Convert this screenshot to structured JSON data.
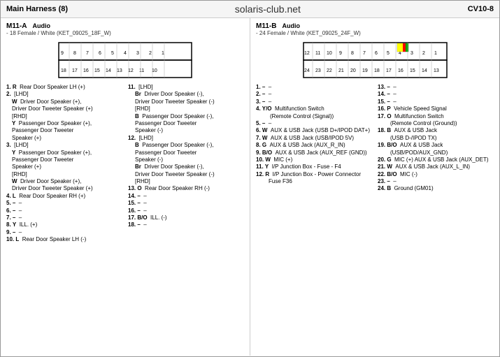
{
  "header": {
    "title": "Main Harness (8)",
    "site": "solaris-club.net",
    "code": "CV10-8"
  },
  "left_panel": {
    "connector": "M11-A",
    "type": "Audio",
    "desc": "- 18 Female / White (KET_09025_18F_W)",
    "pins": [
      {
        "num": "1.",
        "color": "R",
        "desc": "Rear Door Speaker LH (+)"
      },
      {
        "num": "2.",
        "color": "",
        "desc": "[LHD]"
      },
      {
        "num": "",
        "color": "W",
        "desc": "Driver Door Speaker (+),"
      },
      {
        "num": "",
        "color": "",
        "desc": "Driver Door Tweeter Speaker (+)"
      },
      {
        "num": "",
        "color": "",
        "desc": "[RHD]"
      },
      {
        "num": "",
        "color": "Y",
        "desc": "Passenger Door Speaker (+),"
      },
      {
        "num": "",
        "color": "",
        "desc": "Passenger Door Tweeter"
      },
      {
        "num": "",
        "color": "",
        "desc": "Speaker (+)"
      },
      {
        "num": "3.",
        "color": "",
        "desc": "[LHD]"
      },
      {
        "num": "",
        "color": "Y",
        "desc": "Passenger Door Speaker (+),"
      },
      {
        "num": "",
        "color": "",
        "desc": "Passenger Door Tweeter"
      },
      {
        "num": "",
        "color": "",
        "desc": "Speaker (+)"
      },
      {
        "num": "",
        "color": "",
        "desc": "[RHD]"
      },
      {
        "num": "",
        "color": "W",
        "desc": "Driver Door Speaker (+),"
      },
      {
        "num": "",
        "color": "",
        "desc": "Driver Door Tweeter Speaker (+)"
      },
      {
        "num": "4.",
        "color": "L",
        "desc": "Rear Door Speaker RH (+)"
      },
      {
        "num": "5.",
        "color": "–",
        "desc": "–"
      },
      {
        "num": "6.",
        "color": "–",
        "desc": "–"
      },
      {
        "num": "7.",
        "color": "–",
        "desc": "–"
      },
      {
        "num": "8.",
        "color": "Y",
        "desc": "ILL. (+)"
      },
      {
        "num": "9.",
        "color": "–",
        "desc": "–"
      },
      {
        "num": "10.",
        "color": "L",
        "desc": "Rear Door Speaker LH (-)"
      },
      {
        "num": "11.",
        "color": "",
        "desc": "[LHD]"
      },
      {
        "num": "",
        "color": "Br",
        "desc": "Driver Door Speaker (-),"
      },
      {
        "num": "",
        "color": "",
        "desc": "Driver Door Tweeter Speaker (-)"
      },
      {
        "num": "",
        "color": "",
        "desc": "[RHD]"
      },
      {
        "num": "",
        "color": "B",
        "desc": "Passenger Door Speaker (-),"
      },
      {
        "num": "",
        "color": "",
        "desc": "Passenger Door Tweeter"
      },
      {
        "num": "",
        "color": "",
        "desc": "Speaker (-)"
      },
      {
        "num": "12.",
        "color": "",
        "desc": "[LHD]"
      },
      {
        "num": "",
        "color": "B",
        "desc": "Passenger Door Speaker (-),"
      },
      {
        "num": "",
        "color": "",
        "desc": "Passenger Door Tweeter"
      },
      {
        "num": "",
        "color": "",
        "desc": "Speaker (-)"
      },
      {
        "num": "",
        "color": "Br",
        "desc": "Driver Door Speaker (-),"
      },
      {
        "num": "",
        "color": "",
        "desc": "Driver Door Tweeter Speaker (-)"
      },
      {
        "num": "",
        "color": "",
        "desc": "[RHD]"
      },
      {
        "num": "13.",
        "color": "O",
        "desc": "Rear Door Speaker RH (-)"
      },
      {
        "num": "14.",
        "color": "–",
        "desc": "–"
      },
      {
        "num": "15.",
        "color": "–",
        "desc": "–"
      },
      {
        "num": "16.",
        "color": "–",
        "desc": "–"
      },
      {
        "num": "17.",
        "color": "B/O",
        "desc": "ILL. (-)"
      },
      {
        "num": "18.",
        "color": "–",
        "desc": "–"
      }
    ]
  },
  "right_panel": {
    "connector": "M11-B",
    "type": "Audio",
    "desc": "- 24 Female / White (KET_09025_24F_W)",
    "pins": [
      {
        "num": "1.",
        "color": "–",
        "desc": "–"
      },
      {
        "num": "2.",
        "color": "–",
        "desc": "–"
      },
      {
        "num": "3.",
        "color": "–",
        "desc": "–"
      },
      {
        "num": "4.",
        "color": "Y/O",
        "desc": "Multifunction Switch (Remote Control (Signal))"
      },
      {
        "num": "5.",
        "color": "–",
        "desc": "–"
      },
      {
        "num": "6.",
        "color": "W",
        "desc": "AUX & USB Jack (USB D+/IPOD DAT+)"
      },
      {
        "num": "7.",
        "color": "W",
        "desc": "AUX & USB Jack (USB/IPOD 5V)"
      },
      {
        "num": "8.",
        "color": "G",
        "desc": "AUX & USB Jack (AUX_R_IN)"
      },
      {
        "num": "9.",
        "color": "B/O",
        "desc": "AUX & USB Jack (AUX_REF (GND))"
      },
      {
        "num": "10.",
        "color": "W",
        "desc": "MIC (+)"
      },
      {
        "num": "11.",
        "color": "Y",
        "desc": "I/P Junction Box - Fuse - F4"
      },
      {
        "num": "12.",
        "color": "R",
        "desc": "I/P Junction Box - Power Connector Fuse F36"
      },
      {
        "num": "13.",
        "color": "–",
        "desc": "–"
      },
      {
        "num": "14.",
        "color": "–",
        "desc": "–"
      },
      {
        "num": "15.",
        "color": "–",
        "desc": "–"
      },
      {
        "num": "16.",
        "color": "P",
        "desc": "Vehicle Speed Signal"
      },
      {
        "num": "17.",
        "color": "O",
        "desc": "Multifunction Switch (Remote Control (Ground))"
      },
      {
        "num": "18.",
        "color": "B",
        "desc": "AUX & USB Jack (USB D-/IPOD TX)"
      },
      {
        "num": "19.",
        "color": "B/O",
        "desc": "AUX & USB Jack (USB/POD/AUX_GND)"
      },
      {
        "num": "20.",
        "color": "G",
        "desc": "MIC (+) AUX & USB Jack (AUX_DET)"
      },
      {
        "num": "21.",
        "color": "W",
        "desc": "AUX & USB Jack (AUX_L_IN)"
      },
      {
        "num": "22.",
        "color": "B/O",
        "desc": "MIC (-)"
      },
      {
        "num": "23.",
        "color": "–",
        "desc": "–"
      },
      {
        "num": "24.",
        "color": "B",
        "desc": "Ground (GM01)"
      }
    ]
  }
}
